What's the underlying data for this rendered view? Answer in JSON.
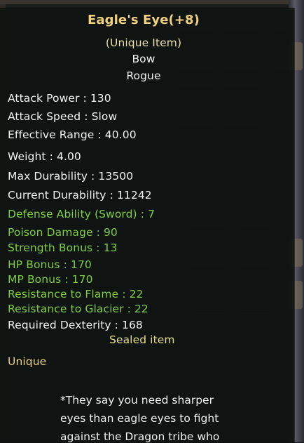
{
  "item": {
    "name": "Eagle's Eye(+8)",
    "rarity_label": "(Unique Item)",
    "item_type": "Bow",
    "class": "Rogue"
  },
  "stats": {
    "attack_power": "Attack Power : 130",
    "attack_speed": "Attack Speed : Slow",
    "effective_range": "Effective Range : 40.00",
    "weight": "Weight : 4.00",
    "max_durability": "Max Durability : 13500",
    "current_durability": "Current Durability : 11242"
  },
  "bonuses": {
    "defense_ability": "Defense Ability (Sword) : 7",
    "poison_damage": "Poison Damage : 90",
    "strength_bonus": "Strength Bonus : 13",
    "hp_bonus": "HP Bonus : 170",
    "mp_bonus": "MP Bonus : 170",
    "resistance_flame": "Resistance to Flame : 22",
    "resistance_glacier": "Resistance to Glacier : 22"
  },
  "requirements": {
    "required_dexterity": "Required Dexterity : 168"
  },
  "sealed_label": "Sealed item",
  "grade_label": "Unique",
  "lore": {
    "line1": "*They say you need sharper",
    "line2": "eyes than eagle eyes to fight",
    "line3": "against the Dragon tribe who"
  },
  "colors": {
    "title": "#f1d27b",
    "white_text": "#f4f4f4",
    "bonus_text": "#7ecf3c",
    "sealed_text": "#e6df7e",
    "tooltip_bg": "#0e1210"
  }
}
